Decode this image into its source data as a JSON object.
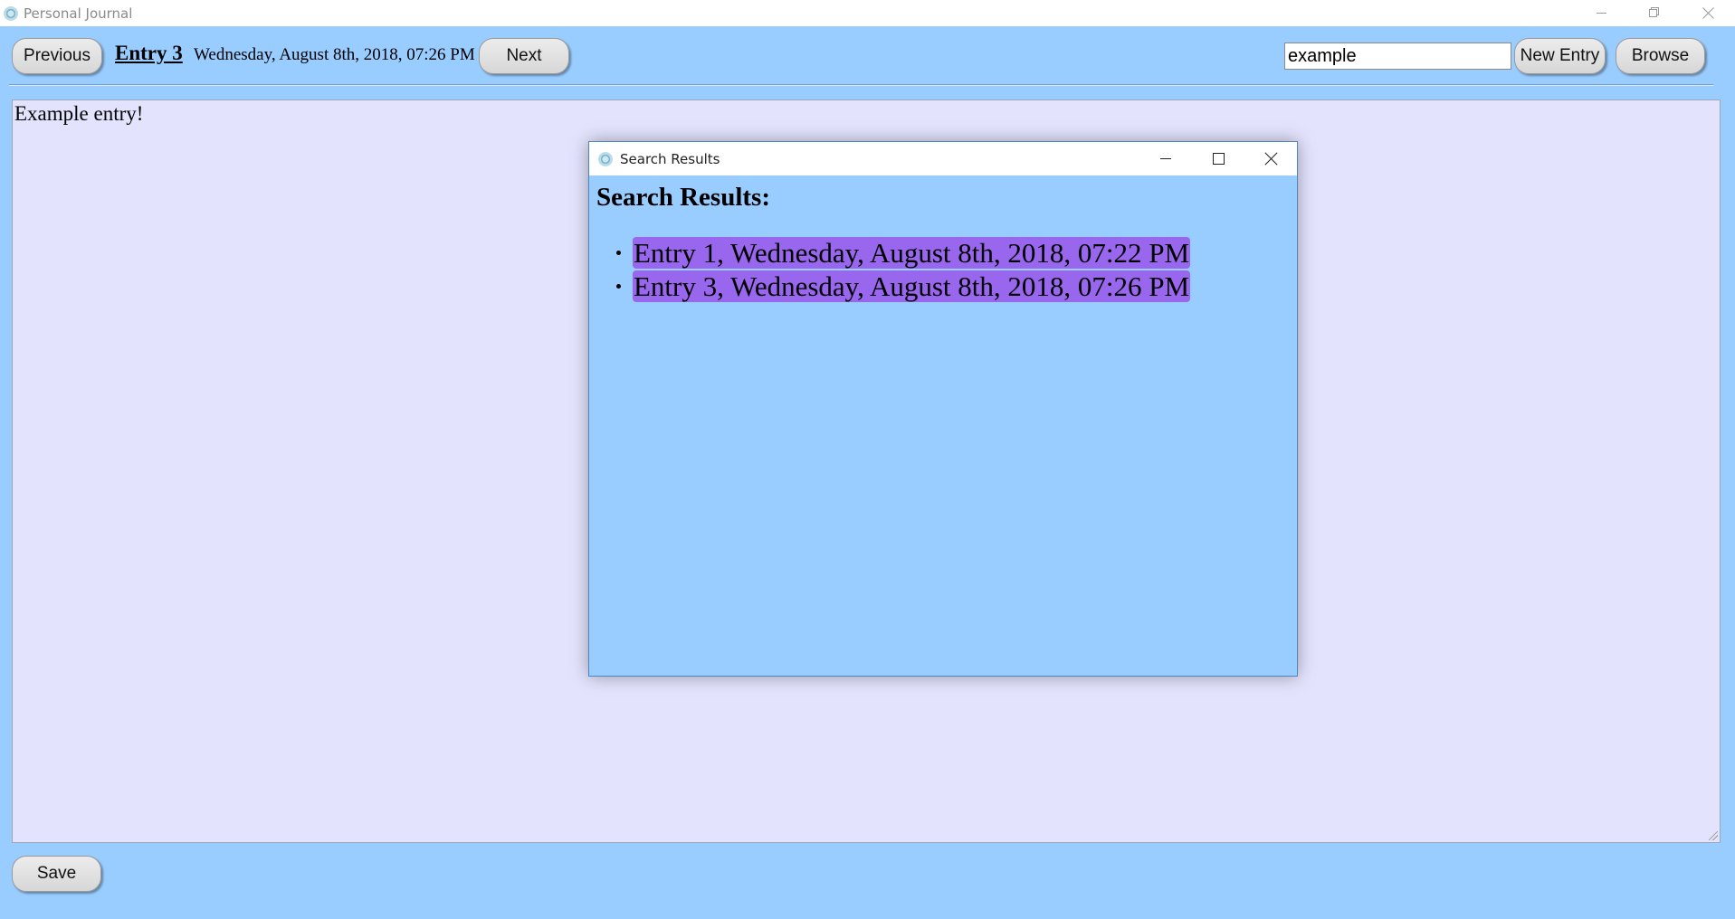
{
  "window": {
    "title": "Personal Journal",
    "icon": "app-logo-icon"
  },
  "toolbar": {
    "previous_label": "Previous",
    "entry_title": "Entry 3",
    "entry_date": "Wednesday, August 8th, 2018, 07:26 PM",
    "next_label": "Next",
    "search_value": "example",
    "new_entry_label": "New Entry",
    "browse_label": "Browse"
  },
  "editor": {
    "content": "Example entry!"
  },
  "footer": {
    "save_label": "Save"
  },
  "dialog": {
    "title": "Search Results",
    "heading": "Search Results:",
    "results": [
      "Entry 1, Wednesday, August 8th, 2018, 07:22 PM",
      "Entry 3, Wednesday, August 8th, 2018, 07:26 PM"
    ]
  },
  "colors": {
    "background": "#99ccff",
    "editor_background": "#e3e3fd",
    "result_highlight": "#9966ee",
    "button_face": "#dddddd"
  }
}
